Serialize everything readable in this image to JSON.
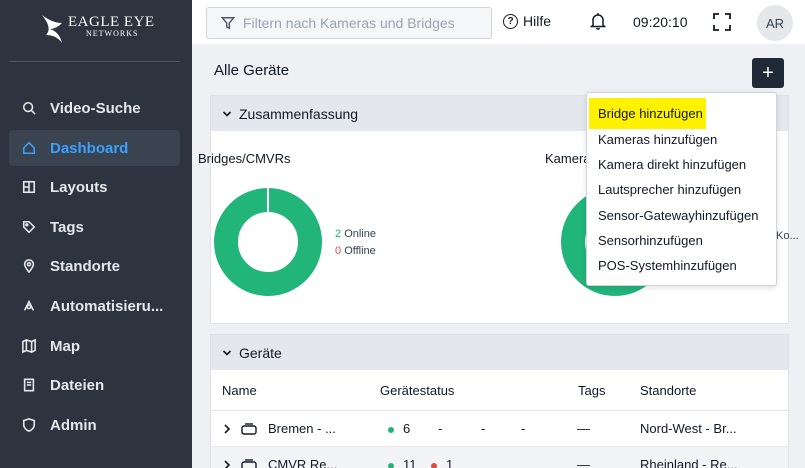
{
  "brand": {
    "name": "EAGLE EYE",
    "sub": "NETWORKS"
  },
  "sidebar": {
    "items": [
      {
        "label": "Video-Suche",
        "icon": "search-icon"
      },
      {
        "label": "Dashboard",
        "icon": "home-icon",
        "active": true
      },
      {
        "label": "Layouts",
        "icon": "layout-icon"
      },
      {
        "label": "Tags",
        "icon": "tag-icon"
      },
      {
        "label": "Standorte",
        "icon": "location-icon"
      },
      {
        "label": "Automatisieru...",
        "icon": "automation-icon"
      },
      {
        "label": "Map",
        "icon": "map-icon"
      },
      {
        "label": "Dateien",
        "icon": "folder-icon"
      },
      {
        "label": "Admin",
        "icon": "shield-icon"
      }
    ]
  },
  "topbar": {
    "search_placeholder": "Filtern nach Kameras und Bridges",
    "help_label": "Hilfe",
    "time": "09:20:10",
    "avatar_initials": "AR"
  },
  "main": {
    "title": "Alle Geräte",
    "add_label": "+",
    "summary": {
      "title": "Zusammenfassung",
      "bridges_label": "Bridges/CMVRs",
      "online_count": "2",
      "online_label": "Online",
      "offline_count": "0",
      "offline_label": "Offline",
      "cameras_label": "Kamera",
      "cameras_legend_partial": "Ko..."
    },
    "devices": {
      "title": "Geräte",
      "columns": [
        "Name",
        "Gerätestatus",
        "Tags",
        "Standorte"
      ],
      "rows": [
        {
          "name": "Bremen - ...",
          "online": "6",
          "offline": "",
          "tags": "—",
          "location": "Nord-West - Br..."
        },
        {
          "name": "CMVR Re...",
          "online": "11",
          "offline": "1",
          "tags": "—",
          "location": "Rheinland - Re..."
        }
      ]
    }
  },
  "menu": {
    "items": [
      "Bridge hinzufügen",
      "Kameras hinzufügen",
      "Kamera direkt hinzufügen",
      "Lautsprecher hinzufügen",
      "Sensor-Gatewayhinzufügen",
      "Sensorhinzufügen",
      "POS-Systemhinzufügen"
    ],
    "highlight_color": "#fff200"
  },
  "colors": {
    "online": "#22b57a",
    "offline": "#e24a4a",
    "accent": "#3aa0ff",
    "sidebar": "#2d3440"
  }
}
